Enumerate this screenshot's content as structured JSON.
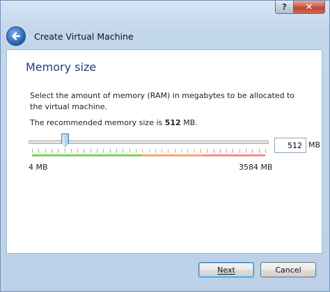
{
  "window": {
    "title": "Create Virtual Machine",
    "help_glyph": "?",
    "close_glyph": "✕"
  },
  "page": {
    "title": "Memory size",
    "description": "Select the amount of memory (RAM) in megabytes to be allocated to the virtual machine.",
    "recommend_prefix": "The recommended memory size is ",
    "recommend_value": "512",
    "recommend_suffix": " MB."
  },
  "memory": {
    "min_mb": 4,
    "max_mb": 3584,
    "value_mb": 512,
    "min_label": "4 MB",
    "max_label": "3584 MB",
    "value_text": "512",
    "unit": "MB"
  },
  "colors": {
    "safe": "#7ccf6a",
    "warning": "#f2a57a",
    "danger": "#ef8f8f",
    "title_blue": "#1a3e7c"
  },
  "buttons": {
    "next": "Next",
    "cancel": "Cancel"
  }
}
